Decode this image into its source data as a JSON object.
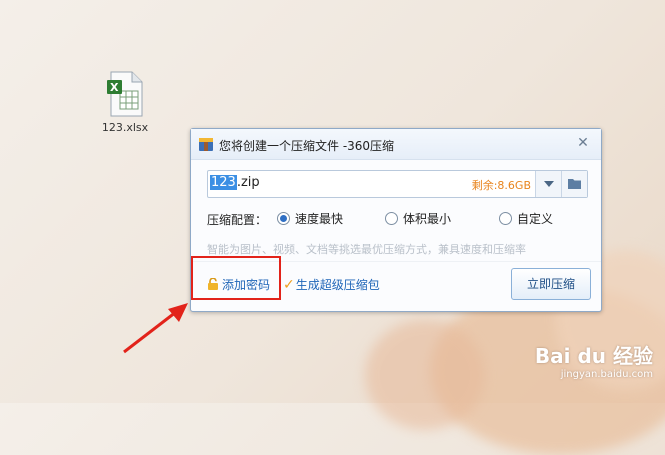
{
  "desktop": {
    "file_label": "123.xlsx"
  },
  "dialog": {
    "title": "您将创建一个压缩文件 -360压缩",
    "filename_selected": "123",
    "filename_ext": ".zip",
    "space_remaining": "剩余:8.6GB",
    "config_label": "压缩配置：",
    "options": [
      "速度最快",
      "体积最小",
      "自定义"
    ],
    "selected_option": "速度最快",
    "hint": "智能为图片、视频、文档等挑选最优压缩方式，兼具速度和压缩率",
    "add_password": "添加密码",
    "super_pack": "生成超级压缩包",
    "compress_button": "立即压缩"
  },
  "watermark": {
    "brand": "Bai du 经验",
    "url": "jingyan.baidu.com"
  },
  "colors": {
    "highlight": "#e2231a",
    "link": "#2066b8",
    "space": "#e8841d"
  }
}
